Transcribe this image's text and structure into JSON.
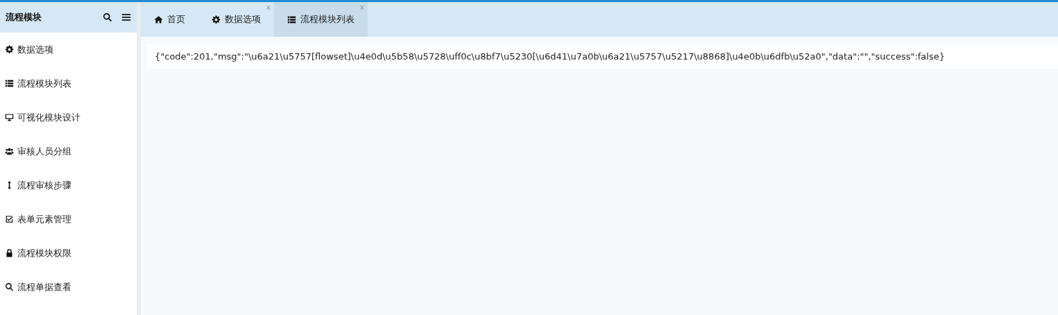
{
  "sidebar": {
    "title": "流程模块",
    "items": [
      {
        "label": "数据选项"
      },
      {
        "label": "流程模块列表"
      },
      {
        "label": "可视化模块设计"
      },
      {
        "label": "审核人员分组"
      },
      {
        "label": "流程审核步骤"
      },
      {
        "label": "表单元素管理"
      },
      {
        "label": "流程模块权限"
      },
      {
        "label": "流程单据查看"
      }
    ]
  },
  "tabs": [
    {
      "label": "首页",
      "selected": false
    },
    {
      "label": "数据选项",
      "selected": false,
      "close": "x"
    },
    {
      "label": "流程模块列表",
      "selected": true,
      "close": "x"
    }
  ],
  "content": {
    "response": "{\"code\":201,\"msg\":\"\\u6a21\\u5757[flowset]\\u4e0d\\u5b58\\u5728\\uff0c\\u8bf7\\u5230[\\u6d41\\u7a0b\\u6a21\\u5757\\u5217\\u8868]\\u4e0b\\u6dfb\\u52a0\",\"data\":\"\",\"success\":false}"
  }
}
